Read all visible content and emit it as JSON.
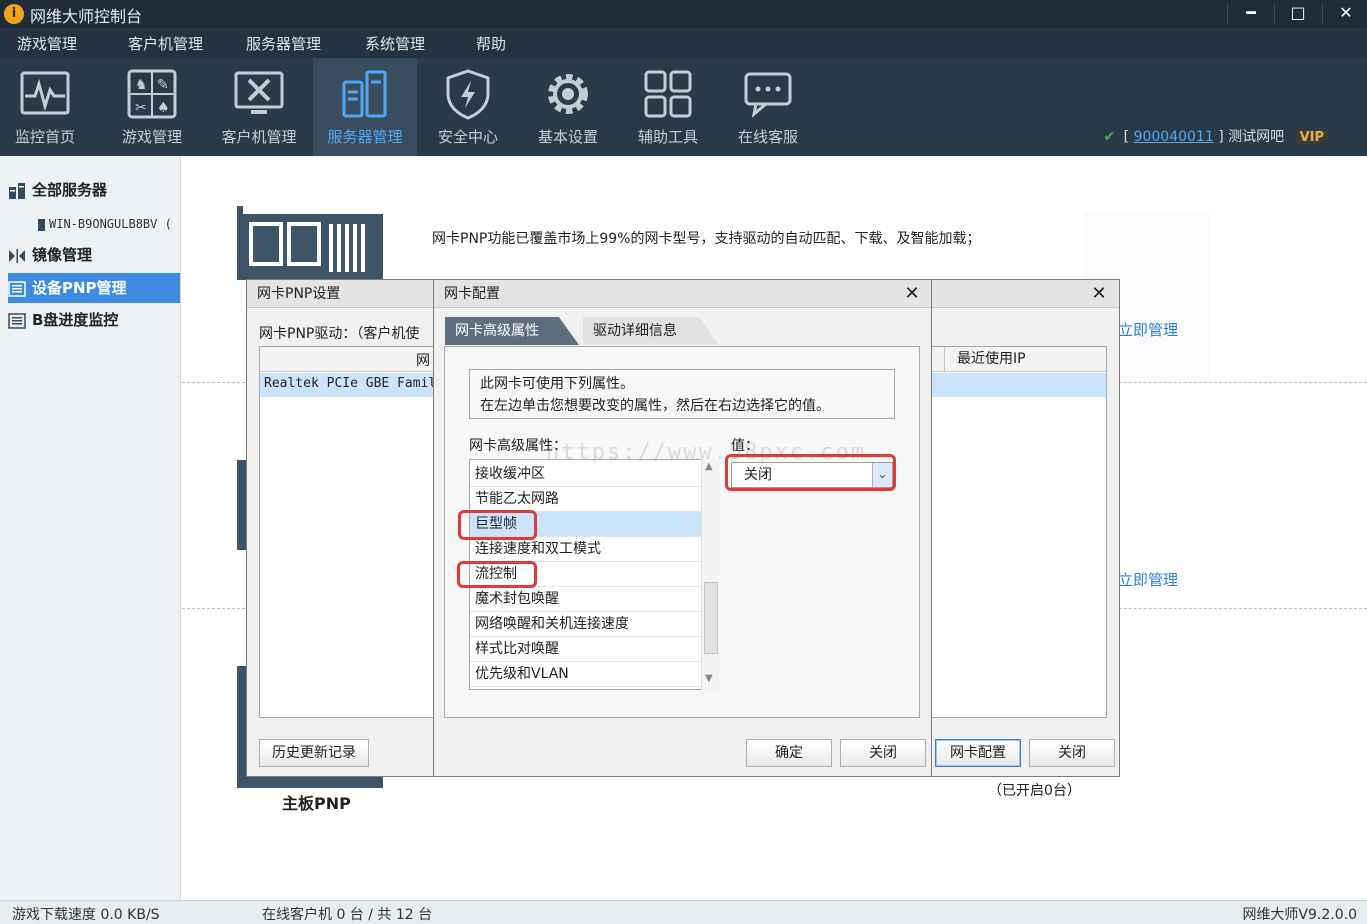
{
  "app": {
    "title": "网维大师控制台",
    "logo_glyph": "i",
    "window_controls": {
      "minimize": "━",
      "maximize": "□",
      "close": "✕"
    }
  },
  "menubar": [
    "游戏管理",
    "客户机管理",
    "服务器管理",
    "系统管理",
    "帮助"
  ],
  "toolbar": {
    "items": [
      {
        "label": "监控首页",
        "icon": "monitor-icon"
      },
      {
        "label": "游戏管理",
        "icon": "game-cards-icon"
      },
      {
        "label": "客户机管理",
        "icon": "tools-icon"
      },
      {
        "label": "服务器管理",
        "icon": "server-icon",
        "active": true
      },
      {
        "label": "安全中心",
        "icon": "shield-icon"
      },
      {
        "label": "基本设置",
        "icon": "gear-icon"
      },
      {
        "label": "辅助工具",
        "icon": "grid-icon"
      },
      {
        "label": "在线客服",
        "icon": "chat-icon"
      }
    ],
    "account": {
      "open_bracket": "[",
      "id": "900040011",
      "close_bracket": "]",
      "bar_name": "测试网吧",
      "vip": "VIP"
    }
  },
  "sidebar": {
    "items": [
      {
        "label": "全部服务器",
        "icon": "server-list-icon"
      },
      {
        "label": "镜像管理",
        "icon": "mirror-icon"
      },
      {
        "label": "设备PNP管理",
        "icon": "device-icon",
        "active": true
      },
      {
        "label": "B盘进度监控",
        "icon": "disk-monitor-icon"
      }
    ],
    "server_node": "WIN-B9ONGULB8BV ("
  },
  "main": {
    "intro": "网卡PNP功能已覆盖市场上99%的网卡型号，支持驱动的自动匹配、下载、及智能加载；",
    "manage_link_1": "立即管理",
    "manage_link_2": "立即管理",
    "motherboard_label": "主板PNP",
    "opened_count": "（已开启0台）",
    "watermark": "https://www.58pxc.com"
  },
  "pnp_dialog": {
    "title": "网卡PNP设置",
    "close_glyph": "✕",
    "driver_label": "网卡PNP驱动：（客户机使",
    "table_header_col1": "网",
    "table_header_col2": "最近使用IP",
    "row_1": "Realtek PCIe GBE Family",
    "history_button": "历史更新记录",
    "config_button": "网卡配置",
    "close_button": "关闭"
  },
  "config_dialog": {
    "title": "网卡配置",
    "close_glyph": "✕",
    "tabs": [
      "网卡高级属性",
      "驱动详细信息"
    ],
    "info_line_1": "此网卡可使用下列属性。",
    "info_line_2": "在左边单击您想要改变的属性，然后在右边选择它的值。",
    "properties_label": "网卡高级属性：",
    "value_label": "值：",
    "properties": [
      "接收缓冲区",
      "节能乙太网路",
      "巨型帧",
      "连接速度和双工模式",
      "流控制",
      "魔术封包唤醒",
      "网络唤醒和关机连接速度",
      "样式比对唤醒",
      "优先级和VLAN"
    ],
    "selected_property": "巨型帧",
    "value": "关闭",
    "ok_button": "确定",
    "close_button": "关闭"
  },
  "statusbar": {
    "download_speed": "游戏下载速度 0.0 KB/S",
    "online_clients": "在线客户机 0 台 / 共 12 台",
    "version": "网维大师V9.2.0.0"
  },
  "colors": {
    "accent": "#3d8be0",
    "highlight_red": "#e23a3a",
    "toolbar_bg": "#2b3a48",
    "selection": "#cce4fb"
  }
}
